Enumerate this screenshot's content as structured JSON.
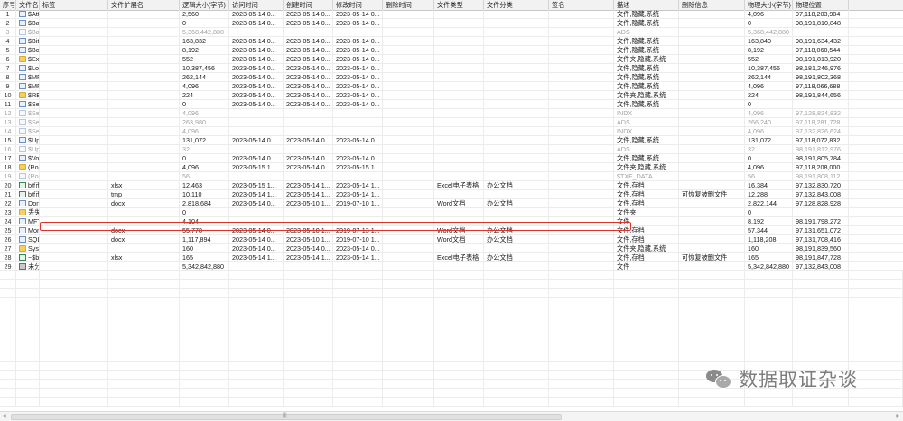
{
  "columns": [
    "序号",
    "文件名",
    "标签",
    "文件扩展名",
    "逻辑大小(字节)",
    "访问时间",
    "创建时间",
    "修改时间",
    "删除时间",
    "文件类型",
    "文件分类",
    "签名",
    "描述",
    "删除信息",
    "物理大小(字节)",
    "物理位置"
  ],
  "rows": [
    {
      "no": "1",
      "icon": "file",
      "name": "$AttrDef",
      "tag": "",
      "ext": "",
      "lsize": "2,560",
      "atime": "2023-05-14 0...",
      "ctime": "2023-05-14 0...",
      "mtime": "2023-05-14 0...",
      "dtime": "",
      "ftype": "",
      "fcat": "",
      "sig": "",
      "desc": "文件,隐藏,系统",
      "del": "",
      "psize": "4,096",
      "ploc": "97,118,203,904",
      "dim": false
    },
    {
      "no": "2",
      "icon": "file",
      "name": "$BadClus",
      "tag": "",
      "ext": "",
      "lsize": "0",
      "atime": "2023-05-14 0...",
      "ctime": "2023-05-14 0...",
      "mtime": "2023-05-14 0...",
      "dtime": "",
      "ftype": "",
      "fcat": "",
      "sig": "",
      "desc": "文件,隐藏,系统",
      "del": "",
      "psize": "0",
      "ploc": "98,191,810,848",
      "dim": false
    },
    {
      "no": "3",
      "icon": "filedim",
      "name": "$BadClus>$Bad",
      "tag": "",
      "ext": "",
      "lsize": "5,368,442,880",
      "atime": "",
      "ctime": "",
      "mtime": "",
      "dtime": "",
      "ftype": "",
      "fcat": "",
      "sig": "",
      "desc": "ADS",
      "del": "",
      "psize": "5,368,442,880",
      "ploc": "",
      "dim": true
    },
    {
      "no": "4",
      "icon": "file",
      "name": "$Bitmap",
      "tag": "",
      "ext": "",
      "lsize": "163,832",
      "atime": "2023-05-14 0...",
      "ctime": "2023-05-14 0...",
      "mtime": "2023-05-14 0...",
      "dtime": "",
      "ftype": "",
      "fcat": "",
      "sig": "",
      "desc": "文件,隐藏,系统",
      "del": "",
      "psize": "163,840",
      "ploc": "98,191,634,432",
      "dim": false
    },
    {
      "no": "5",
      "icon": "file",
      "name": "$Boot",
      "tag": "",
      "ext": "",
      "lsize": "8,192",
      "atime": "2023-05-14 0...",
      "ctime": "2023-05-14 0...",
      "mtime": "2023-05-14 0...",
      "dtime": "",
      "ftype": "",
      "fcat": "",
      "sig": "",
      "desc": "文件,隐藏,系统",
      "del": "",
      "psize": "8,192",
      "ploc": "97,118,060,544",
      "dim": false
    },
    {
      "no": "6",
      "icon": "folder",
      "name": "$Extend",
      "tag": "",
      "ext": "",
      "lsize": "552",
      "atime": "2023-05-14 0...",
      "ctime": "2023-05-14 0...",
      "mtime": "2023-05-14 0...",
      "dtime": "",
      "ftype": "",
      "fcat": "",
      "sig": "",
      "desc": "文件夹,隐藏,系统",
      "del": "",
      "psize": "552",
      "ploc": "98,191,813,920",
      "dim": false
    },
    {
      "no": "7",
      "icon": "file",
      "name": "$LogFile",
      "tag": "",
      "ext": "",
      "lsize": "10,387,456",
      "atime": "2023-05-14 0...",
      "ctime": "2023-05-14 0...",
      "mtime": "2023-05-14 0...",
      "dtime": "",
      "ftype": "",
      "fcat": "",
      "sig": "",
      "desc": "文件,隐藏,系统",
      "del": "",
      "psize": "10,387,456",
      "ploc": "98,181,246,976",
      "dim": false
    },
    {
      "no": "8",
      "icon": "file",
      "name": "$MFT",
      "tag": "",
      "ext": "",
      "lsize": "262,144",
      "atime": "2023-05-14 0...",
      "ctime": "2023-05-14 0...",
      "mtime": "2023-05-14 0...",
      "dtime": "",
      "ftype": "",
      "fcat": "",
      "sig": "",
      "desc": "文件,隐藏,系统",
      "del": "",
      "psize": "262,144",
      "ploc": "98,191,802,368",
      "dim": false
    },
    {
      "no": "9",
      "icon": "file",
      "name": "$MFTMirr",
      "tag": "",
      "ext": "",
      "lsize": "4,096",
      "atime": "2023-05-14 0...",
      "ctime": "2023-05-14 0...",
      "mtime": "2023-05-14 0...",
      "dtime": "",
      "ftype": "",
      "fcat": "",
      "sig": "",
      "desc": "文件,隐藏,系统",
      "del": "",
      "psize": "4,096",
      "ploc": "97,118,066,688",
      "dim": false
    },
    {
      "no": "10",
      "icon": "folder",
      "name": "$RECYCLE.BIN",
      "tag": "",
      "ext": "",
      "lsize": "224",
      "atime": "2023-05-14 0...",
      "ctime": "2023-05-14 0...",
      "mtime": "2023-05-14 0...",
      "dtime": "",
      "ftype": "",
      "fcat": "",
      "sig": "",
      "desc": "文件夹,隐藏,系统",
      "del": "",
      "psize": "224",
      "ploc": "98,191,844,656",
      "dim": false
    },
    {
      "no": "11",
      "icon": "file",
      "name": "$Secure",
      "tag": "",
      "ext": "",
      "lsize": "0",
      "atime": "2023-05-14 0...",
      "ctime": "2023-05-14 0...",
      "mtime": "2023-05-14 0...",
      "dtime": "",
      "ftype": "",
      "fcat": "",
      "sig": "",
      "desc": "文件,隐藏,系统",
      "del": "",
      "psize": "0",
      "ploc": "",
      "dim": false
    },
    {
      "no": "12",
      "icon": "filedim",
      "name": "$Secure>$SDH",
      "tag": "",
      "ext": "",
      "lsize": "4,096",
      "atime": "",
      "ctime": "",
      "mtime": "",
      "dtime": "",
      "ftype": "",
      "fcat": "",
      "sig": "",
      "desc": "INDX",
      "del": "",
      "psize": "4,096",
      "ploc": "97,128,824,832",
      "dim": true
    },
    {
      "no": "13",
      "icon": "filedim",
      "name": "$Secure>$SDS",
      "tag": "",
      "ext": "",
      "lsize": "263,980",
      "atime": "",
      "ctime": "",
      "mtime": "",
      "dtime": "",
      "ftype": "",
      "fcat": "",
      "sig": "",
      "desc": "ADS",
      "del": "",
      "psize": "266,240",
      "ploc": "97,118,281,728",
      "dim": true
    },
    {
      "no": "14",
      "icon": "filedim",
      "name": "$Secure>$SII",
      "tag": "",
      "ext": "",
      "lsize": "4,096",
      "atime": "",
      "ctime": "",
      "mtime": "",
      "dtime": "",
      "ftype": "",
      "fcat": "",
      "sig": "",
      "desc": "INDX",
      "del": "",
      "psize": "4,096",
      "ploc": "97,132,826,624",
      "dim": true
    },
    {
      "no": "15",
      "icon": "file",
      "name": "$UpCase",
      "tag": "",
      "ext": "",
      "lsize": "131,072",
      "atime": "2023-05-14 0...",
      "ctime": "2023-05-14 0...",
      "mtime": "2023-05-14 0...",
      "dtime": "",
      "ftype": "",
      "fcat": "",
      "sig": "",
      "desc": "文件,隐藏,系统",
      "del": "",
      "psize": "131,072",
      "ploc": "97,118,072,832",
      "dim": false
    },
    {
      "no": "16",
      "icon": "filedim",
      "name": "$UpCase>$Info",
      "tag": "",
      "ext": "",
      "lsize": "32",
      "atime": "",
      "ctime": "",
      "mtime": "",
      "dtime": "",
      "ftype": "",
      "fcat": "",
      "sig": "",
      "desc": "ADS",
      "del": "",
      "psize": "32",
      "ploc": "98,191,812,976",
      "dim": true
    },
    {
      "no": "17",
      "icon": "file",
      "name": "$Volume",
      "tag": "",
      "ext": "",
      "lsize": "0",
      "atime": "2023-05-14 0...",
      "ctime": "2023-05-14 0...",
      "mtime": "2023-05-14 0...",
      "dtime": "",
      "ftype": "",
      "fcat": "",
      "sig": "",
      "desc": "文件,隐藏,系统",
      "del": "",
      "psize": "0",
      "ploc": "98,191,805,784",
      "dim": false
    },
    {
      "no": "18",
      "icon": "folder",
      "name": "(Root directory)",
      "tag": "",
      "ext": "",
      "lsize": "4,096",
      "atime": "2023-05-15 1...",
      "ctime": "2023-05-14 0...",
      "mtime": "2023-05-15 1...",
      "dtime": "",
      "ftype": "",
      "fcat": "",
      "sig": "",
      "desc": "文件夹,隐藏,系统",
      "del": "",
      "psize": "4,096",
      "ploc": "97,118,208,000",
      "dim": false
    },
    {
      "no": "19",
      "icon": "filedim",
      "name": "(Root directory)>...",
      "tag": "",
      "ext": "",
      "lsize": "56",
      "atime": "",
      "ctime": "",
      "mtime": "",
      "dtime": "",
      "ftype": "",
      "fcat": "",
      "sig": "",
      "desc": "$TXF_DATA",
      "del": "",
      "psize": "56",
      "ploc": "98,191,808,112",
      "dim": true
    },
    {
      "no": "20",
      "icon": "excel",
      "name": "btf币地址与受害人x...",
      "tag": "",
      "ext": "xlsx",
      "lsize": "12,463",
      "atime": "2023-05-15 1...",
      "ctime": "2023-05-14 1...",
      "mtime": "2023-05-14 1...",
      "dtime": "",
      "ftype": "Excel电子表格",
      "fcat": "办公文档",
      "sig": "",
      "desc": "文件,存档",
      "del": "",
      "psize": "16,384",
      "ploc": "97,132,830,720",
      "dim": false
    },
    {
      "no": "21",
      "icon": "excel",
      "name": "btf币地址与受害人...",
      "tag": "",
      "ext": "tmp",
      "lsize": "10,110",
      "atime": "2023-05-14 1...",
      "ctime": "2023-05-14 1...",
      "mtime": "2023-05-14 1...",
      "dtime": "",
      "ftype": "",
      "fcat": "",
      "sig": "",
      "desc": "文件,存档",
      "del": "可恢复被删文件",
      "psize": "12,288",
      "ploc": "97,132,843,008",
      "dim": false
    },
    {
      "no": "22",
      "icon": "file",
      "name": "Donot团伙（APT...",
      "tag": "",
      "ext": "docx",
      "lsize": "2,818,684",
      "atime": "2023-05-14 0...",
      "ctime": "2023-05-10 1...",
      "mtime": "2019-07-10 1...",
      "dtime": "",
      "ftype": "Word文档",
      "fcat": "办公文档",
      "sig": "",
      "desc": "文件,存档",
      "del": "",
      "psize": "2,822,144",
      "ploc": "97,128,828,928",
      "dim": false
    },
    {
      "no": "23",
      "icon": "folder",
      "name": "丢失文件",
      "tag": "",
      "ext": "",
      "lsize": "0",
      "atime": "",
      "ctime": "",
      "mtime": "",
      "dtime": "",
      "ftype": "",
      "fcat": "",
      "sig": "",
      "desc": "文件夹",
      "del": "",
      "psize": "0",
      "ploc": "",
      "dim": false
    },
    {
      "no": "24",
      "icon": "file",
      "name": "MFT Allocation Bit...",
      "tag": "",
      "ext": "",
      "lsize": "4,104",
      "atime": "",
      "ctime": "",
      "mtime": "",
      "dtime": "",
      "ftype": "",
      "fcat": "",
      "sig": "",
      "desc": "文件",
      "del": "",
      "psize": "8,192",
      "ploc": "98,191,798,272",
      "dim": false
    },
    {
      "no": "25",
      "icon": "file",
      "name": "Mongodb-Redis...",
      "tag": "",
      "ext": "docx",
      "lsize": "55,778",
      "atime": "2023-05-14 0...",
      "ctime": "2023-05-10 1...",
      "mtime": "2019-07-13 1...",
      "dtime": "",
      "ftype": "Word文档",
      "fcat": "办公文档",
      "sig": "",
      "desc": "文件,存档",
      "del": "",
      "psize": "57,344",
      "ploc": "97,131,651,072",
      "dim": false
    },
    {
      "no": "26",
      "icon": "file",
      "name": "SQL注入有趣姿势...",
      "tag": "",
      "ext": "docx",
      "lsize": "1,117,894",
      "atime": "2023-05-14 0...",
      "ctime": "2023-05-10 1...",
      "mtime": "2019-07-10 1...",
      "dtime": "",
      "ftype": "Word文档",
      "fcat": "办公文档",
      "sig": "",
      "desc": "文件,存档",
      "del": "",
      "psize": "1,118,208",
      "ploc": "97,131,708,416",
      "dim": false
    },
    {
      "no": "27",
      "icon": "folder",
      "name": "System Volume In...",
      "tag": "",
      "ext": "",
      "lsize": "160",
      "atime": "2023-05-14 0...",
      "ctime": "2023-05-14 0...",
      "mtime": "2023-05-14 0...",
      "dtime": "",
      "ftype": "",
      "fcat": "",
      "sig": "",
      "desc": "文件夹,隐藏,系统",
      "del": "",
      "psize": "160",
      "ploc": "98,191,839,560",
      "dim": false
    },
    {
      "no": "28",
      "icon": "excel",
      "name": "~$bit币地址与受...",
      "tag": "",
      "ext": "xlsx",
      "lsize": "165",
      "atime": "2023-05-14 1...",
      "ctime": "2023-05-14 1...",
      "mtime": "2023-05-14 1...",
      "dtime": "",
      "ftype": "Excel电子表格",
      "fcat": "办公文档",
      "sig": "",
      "desc": "文件,存档",
      "del": "可恢复被删文件",
      "psize": "165",
      "ploc": "98,191,847,728",
      "dim": false
    },
    {
      "no": "29",
      "icon": "sys",
      "name": "未分配簇",
      "tag": "",
      "ext": "",
      "lsize": "5,342,842,880",
      "atime": "",
      "ctime": "",
      "mtime": "",
      "dtime": "",
      "ftype": "",
      "fcat": "",
      "sig": "",
      "desc": "文件",
      "del": "",
      "psize": "5,342,842,880",
      "ploc": "97,132,843,008",
      "dim": false
    }
  ],
  "highlighted_row": "21",
  "watermark": "数据取证杂谈",
  "colors": {
    "highlight_border": "#e0322a",
    "header_bg": "#f2f2f2",
    "dim_text": "#a2a2a2"
  }
}
